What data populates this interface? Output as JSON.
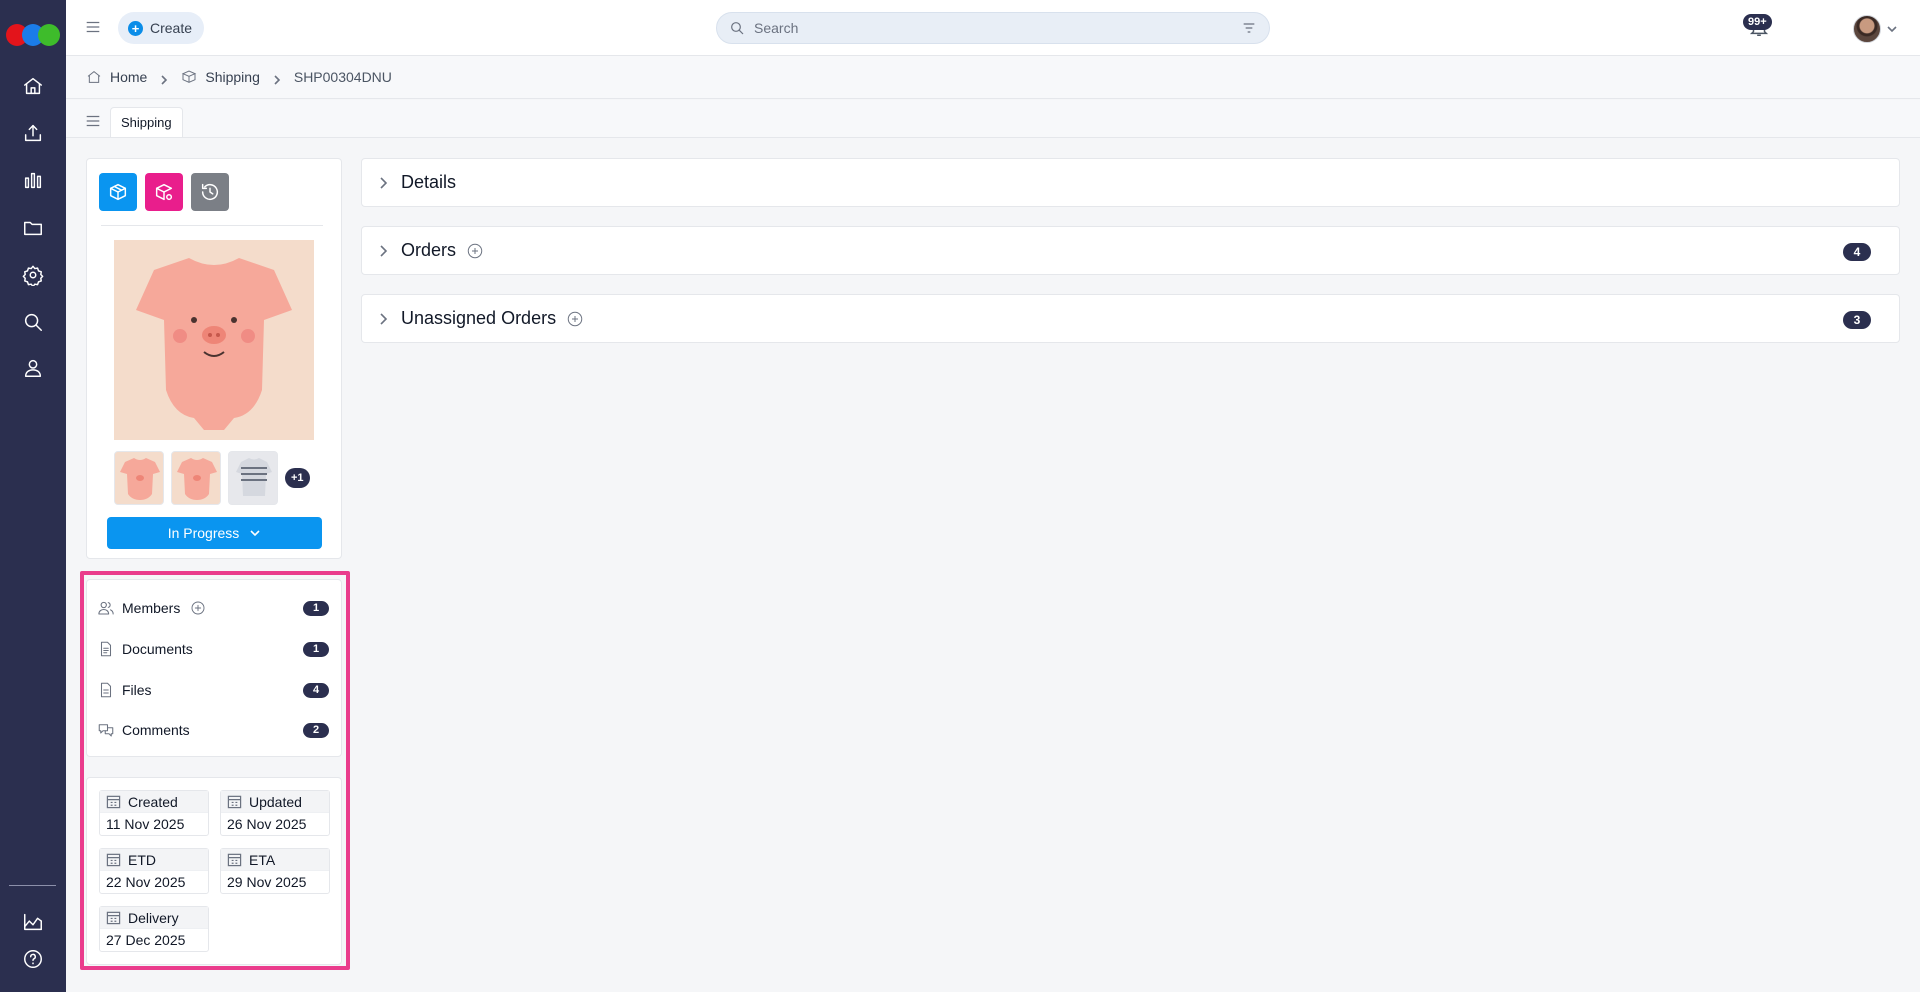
{
  "app": {
    "create_label": "Create",
    "search_placeholder": "Search",
    "notification_count": "99+",
    "accent_color": "#0a95f0",
    "rail_color": "#2b2f4f",
    "highlight_color": "#ea3c8c"
  },
  "rail": {
    "icons": [
      "home-icon",
      "upload-icon",
      "chart-icon",
      "folder-icon",
      "settings-icon",
      "search-icon",
      "user-icon",
      "reports-icon",
      "help-icon"
    ]
  },
  "breadcrumb": {
    "home": "Home",
    "section": "Shipping",
    "current": "SHP00304DNU"
  },
  "tabs": [
    {
      "label": "Shipping",
      "active": true
    }
  ],
  "panel": {
    "action_buttons": [
      {
        "name": "shipment-box-icon",
        "color": "#0a95f0"
      },
      {
        "name": "package-settings-icon",
        "color": "#e91e8c"
      },
      {
        "name": "history-icon",
        "color": "#7b7f86"
      }
    ],
    "more_images": "+1",
    "status": "In Progress"
  },
  "links": [
    {
      "label": "Members",
      "count": "1",
      "icon": "members-icon",
      "addable": true
    },
    {
      "label": "Documents",
      "count": "1",
      "icon": "document-icon",
      "addable": false
    },
    {
      "label": "Files",
      "count": "4",
      "icon": "file-icon",
      "addable": false
    },
    {
      "label": "Comments",
      "count": "2",
      "icon": "comments-icon",
      "addable": false
    }
  ],
  "dates": [
    {
      "label": "Created",
      "value": "11 Nov 2025"
    },
    {
      "label": "Updated",
      "value": "26 Nov 2025"
    },
    {
      "label": "ETD",
      "value": "22 Nov 2025"
    },
    {
      "label": "ETA",
      "value": "29 Nov 2025"
    },
    {
      "label": "Delivery",
      "value": "27 Dec 2025"
    }
  ],
  "sections": [
    {
      "title": "Details",
      "count": "",
      "addable": false
    },
    {
      "title": "Orders",
      "count": "4",
      "addable": true
    },
    {
      "title": "Unassigned Orders",
      "count": "3",
      "addable": true
    }
  ]
}
